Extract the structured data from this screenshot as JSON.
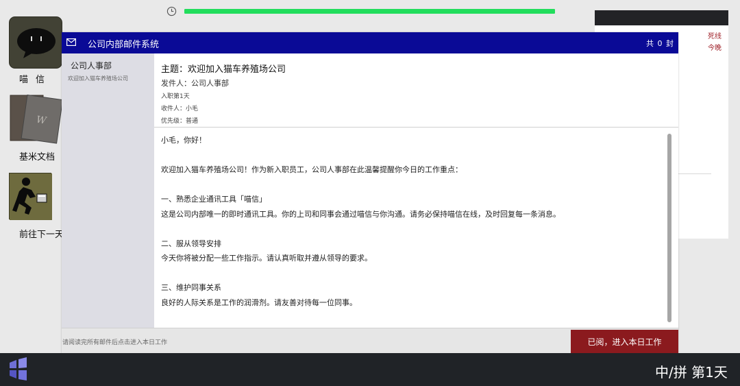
{
  "timer": {
    "progress": 1.0,
    "icon": "clock-icon",
    "fill_color": "#22dd5c"
  },
  "desktop": {
    "icons": [
      {
        "label": "喵信",
        "icon": "chat-bubble-icon"
      },
      {
        "label": "基米文档",
        "icon": "documents-icon"
      },
      {
        "label": "前往下一天",
        "icon": "running-man-exit-icon"
      }
    ]
  },
  "background_window": {
    "side_text": [
      "死线",
      "今晚"
    ]
  },
  "mail": {
    "title": "公司内部邮件系统",
    "count": "共 0 封",
    "list": [
      {
        "sender": "公司人事部",
        "preview": "欢迎加入猫车养殖场公司"
      }
    ],
    "header": {
      "subject": "主题：欢迎加入猫车养殖场公司",
      "from": "发件人：公司人事部",
      "date": "入职第1天",
      "to": "收件人：小毛",
      "priority": "优先级：普通"
    },
    "body_lines": [
      "小毛，你好！",
      "",
      "欢迎加入猫车养殖场公司！作为新入职员工，公司人事部在此温馨提醒你今日的工作重点：",
      "",
      "一、熟悉企业通讯工具「喵信」",
      "这是公司内部唯一的即时通讯工具。你的上司和同事会通过喵信与你沟通。请务必保持喵信在线，及时回复每一条消息。",
      "",
      "二、服从领导安排",
      "今天你将被分配一些工作指示。请认真听取并遵从领导的要求。",
      "",
      "三、维护同事关系",
      "良好的人际关系是工作的润滑剂。请友善对待每一位同事。"
    ],
    "footer_hint": "请阅读完所有邮件后点击进入本日工作",
    "confirm_button": "已阅，进入本日工作"
  },
  "taskbar": {
    "ime": "中/拼",
    "day": "第1天",
    "start_icon": "start-menu-icon"
  },
  "colors": {
    "titlebar": "#0a0a96",
    "confirm_button": "#8b1a1e",
    "taskbar": "#202327",
    "desktop": "#e9e9e9"
  }
}
